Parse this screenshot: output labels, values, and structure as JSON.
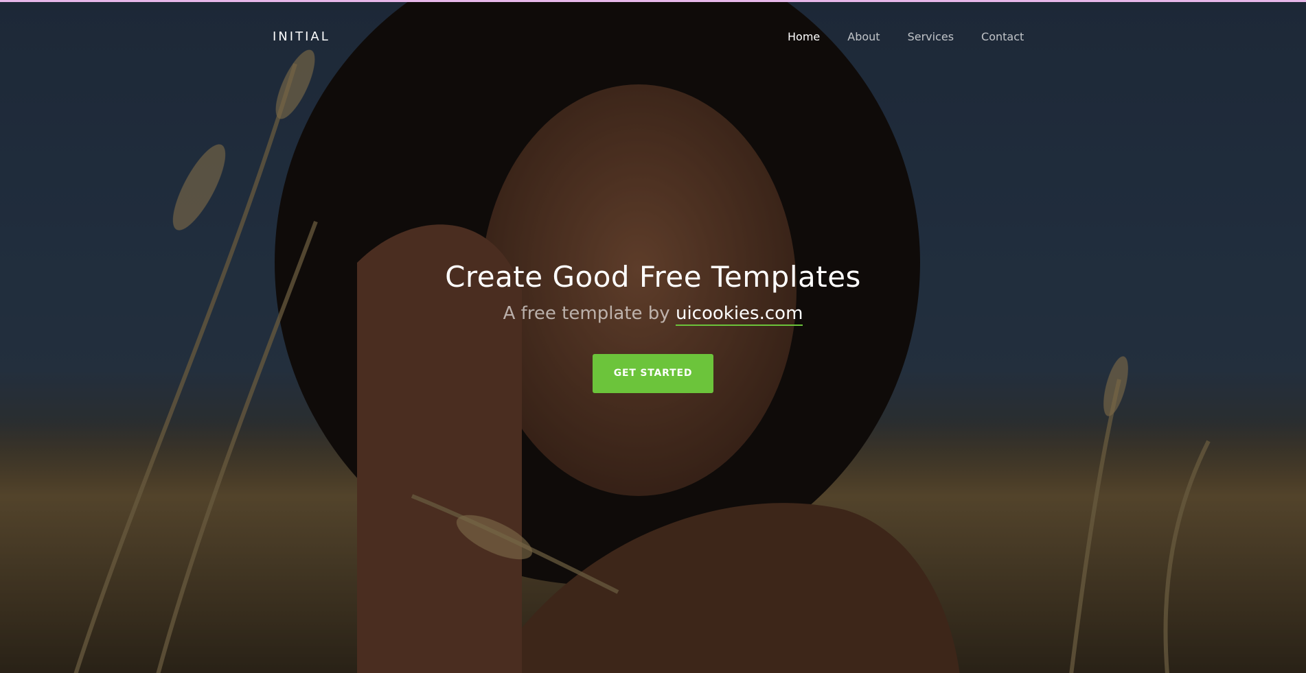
{
  "page": {
    "accent_color": "#6cc43b",
    "top_strip_color": "#e6b7e9"
  },
  "navbar": {
    "brand": "INITIAL",
    "links": [
      {
        "label": "Home",
        "active": true
      },
      {
        "label": "About",
        "active": false
      },
      {
        "label": "Services",
        "active": false
      },
      {
        "label": "Contact",
        "active": false
      }
    ]
  },
  "hero": {
    "background": "woman-in-wheat-field-photo",
    "title": "Create Good Free Templates",
    "subtitle_prefix": "A free template by",
    "subtitle_link": "uicookies.com",
    "cta_label": "GET STARTED"
  }
}
